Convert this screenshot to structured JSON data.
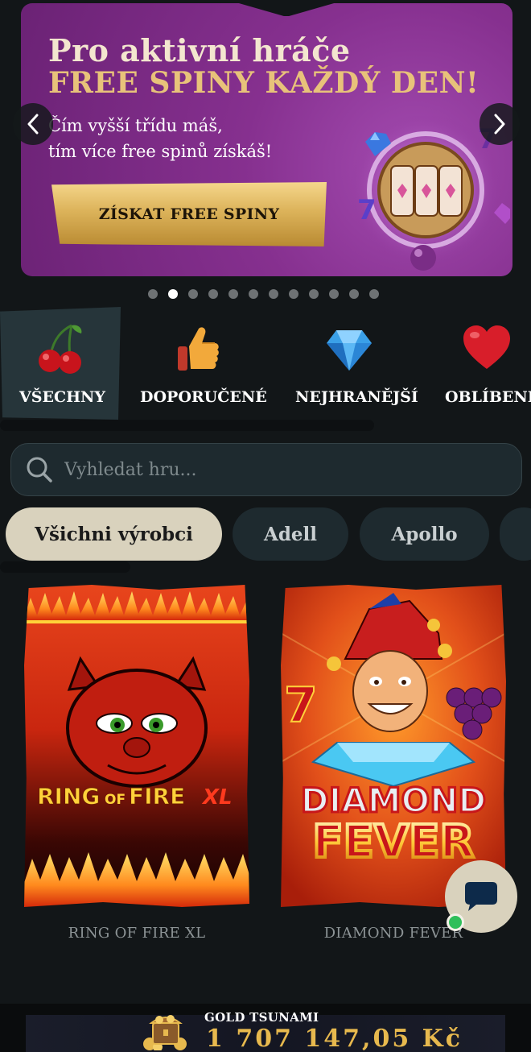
{
  "banner": {
    "title_line1": "Pro aktivní hráče",
    "title_line2": "FREE SPINY KAŽDÝ DEN!",
    "subtitle_line1": "Čím vyšší třídu máš,",
    "subtitle_line2": "tím více free spinů získáš!",
    "cta_label": "ZÍSKAT FREE SPINY",
    "slides_total": 12,
    "active_slide": 2
  },
  "categories": [
    {
      "label": "VŠECHNY",
      "icon": "cherries-icon",
      "active": true
    },
    {
      "label": "DOPORUČENÉ",
      "icon": "thumbs-up-icon",
      "active": false
    },
    {
      "label": "NEJHRANĚJŠÍ",
      "icon": "diamond-icon",
      "active": false
    },
    {
      "label": "OBLÍBENÉ",
      "icon": "heart-icon",
      "active": false
    }
  ],
  "search": {
    "placeholder": "Vyhledat hru..."
  },
  "providers": [
    {
      "label": "Všichni výrobci",
      "active": true
    },
    {
      "label": "Adell",
      "active": false
    },
    {
      "label": "Apollo",
      "active": false
    }
  ],
  "games": [
    {
      "title": "RING OF FIRE XL",
      "art_text_main": "RING",
      "art_text_of": "OF",
      "art_text_fire": "FIRE",
      "art_text_xl": "XL"
    },
    {
      "title": "DIAMOND FEVER",
      "art_text_line1": "DIAMOND",
      "art_text_line2": "FEVER"
    }
  ],
  "jackpot": {
    "label": "GOLD TSUNAMI",
    "amount": "1 707 147,05 Kč"
  },
  "colors": {
    "background": "#121618",
    "banner": "#86308f",
    "gold": "#e7b94e",
    "chip_active": "#d9d2bd"
  }
}
